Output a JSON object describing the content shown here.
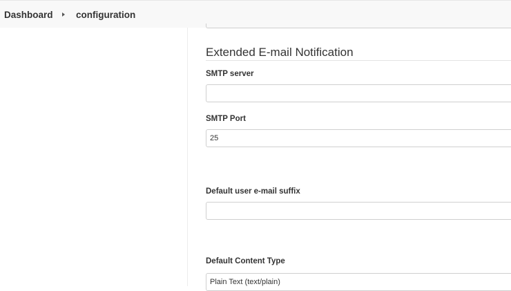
{
  "breadcrumb": {
    "items": [
      "Dashboard",
      "configuration"
    ]
  },
  "section": {
    "title": "Extended E-mail Notification"
  },
  "fields": {
    "smtp_server": {
      "label": "SMTP server",
      "value": ""
    },
    "smtp_port": {
      "label": "SMTP Port",
      "value": "25"
    },
    "email_suffix": {
      "label": "Default user e-mail suffix",
      "value": ""
    },
    "content_type": {
      "label": "Default Content Type",
      "selected": "Plain Text (text/plain)"
    }
  },
  "icons": {
    "breadcrumb_separator": "chevron-right-icon"
  }
}
